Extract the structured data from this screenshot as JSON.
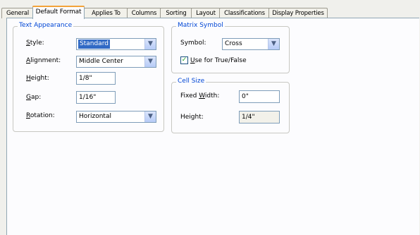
{
  "tabs": [
    "General",
    "Default Format",
    "Applies To",
    "Columns",
    "Sorting",
    "Layout",
    "Classifications",
    "Display Properties"
  ],
  "active_tab": "Default Format",
  "text_appearance": {
    "legend": "Text Appearance",
    "style": {
      "label_key": "S",
      "label_rest": "tyle:",
      "value": "Standard"
    },
    "alignment": {
      "label_key": "A",
      "label_rest": "lignment:",
      "value": "Middle Center"
    },
    "height": {
      "label_key": "H",
      "label_rest": "eight:",
      "value": "1/8\""
    },
    "gap": {
      "label_key": "G",
      "label_rest": "ap:",
      "value": "1/16\""
    },
    "rotation": {
      "label_key": "R",
      "label_rest": "otation:",
      "value": "Horizontal"
    }
  },
  "matrix_symbol": {
    "legend": "Matrix Symbol",
    "symbol_label": "Symbol:",
    "symbol_value": "Cross",
    "use_tf_key": "U",
    "use_tf_rest": "se for True/False",
    "use_tf_checked": true
  },
  "cell_size": {
    "legend": "Cell Size",
    "fixed_width_pre": "Fixed ",
    "fixed_width_key": "W",
    "fixed_width_rest": "idth:",
    "fixed_width_value": "0\"",
    "height_label": "Height:",
    "height_value": "1/4\""
  },
  "colors": {
    "accent_tab": "#f3a33a",
    "legend": "#0046d5",
    "selection": "#316ac5"
  }
}
